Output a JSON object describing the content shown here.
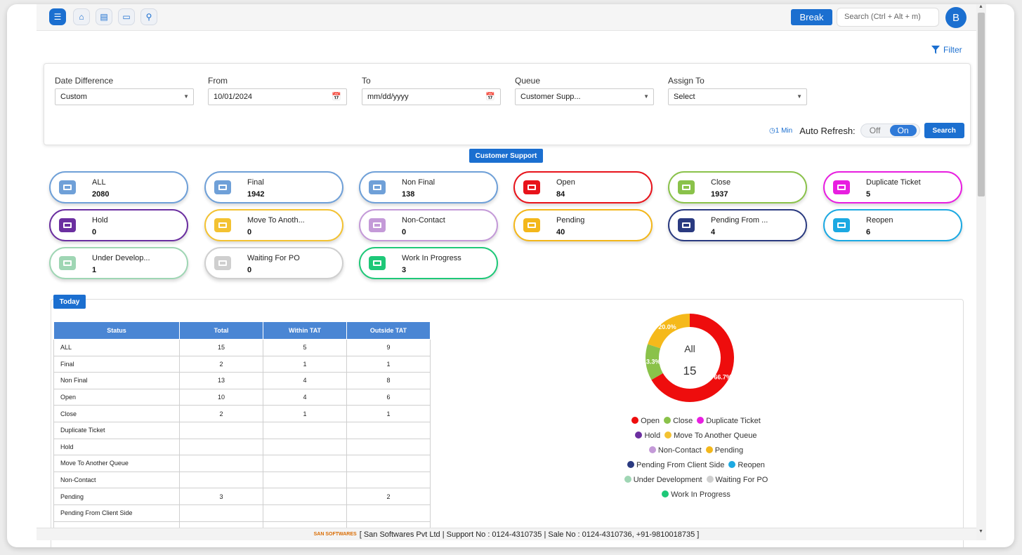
{
  "topbar": {
    "icons": [
      "menu-icon",
      "home-icon",
      "document-icon",
      "ticket-icon",
      "search-icon"
    ],
    "break_label": "Break",
    "search_placeholder": "Search (Ctrl + Alt + m)",
    "avatar_initial": "B"
  },
  "filter_link": "Filter",
  "filters": {
    "date_difference": {
      "label": "Date Difference",
      "value": "Custom"
    },
    "from": {
      "label": "From",
      "value": "10/01/2024"
    },
    "to": {
      "label": "To",
      "value": "mm/dd/yyyy"
    },
    "queue": {
      "label": "Queue",
      "value": "Customer Supp..."
    },
    "assign_to": {
      "label": "Assign To",
      "value": "Select"
    },
    "refresh_interval": "1 Min",
    "auto_refresh_label": "Auto Refresh:",
    "toggle_off": "Off",
    "toggle_on": "On",
    "search_button": "Search"
  },
  "section_title": "Customer Support",
  "status_cards": [
    {
      "label": "ALL",
      "count": "2080",
      "color": "#6fa0d8"
    },
    {
      "label": "Final",
      "count": "1942",
      "color": "#6fa0d8"
    },
    {
      "label": "Non Final",
      "count": "138",
      "color": "#6fa0d8"
    },
    {
      "label": "Open",
      "count": "84",
      "color": "#e8131b"
    },
    {
      "label": "Close",
      "count": "1937",
      "color": "#8ac24a"
    },
    {
      "label": "Duplicate Ticket",
      "count": "5",
      "color": "#e81ee0"
    },
    {
      "label": "Hold",
      "count": "0",
      "color": "#6b2fa0"
    },
    {
      "label": "Move To Anoth...",
      "count": "0",
      "color": "#f3c232"
    },
    {
      "label": "Non-Contact",
      "count": "0",
      "color": "#c49ad8"
    },
    {
      "label": "Pending",
      "count": "40",
      "color": "#f3b71b"
    },
    {
      "label": "Pending From ...",
      "count": "4",
      "color": "#2a3a80"
    },
    {
      "label": "Reopen",
      "count": "6",
      "color": "#1ca9e2"
    },
    {
      "label": "Under Develop...",
      "count": "1",
      "color": "#9fd6b4"
    },
    {
      "label": "Waiting For PO",
      "count": "0",
      "color": "#cfcfcf"
    },
    {
      "label": "Work In Progress",
      "count": "3",
      "color": "#1ec878"
    }
  ],
  "today": {
    "title": "Today",
    "columns": [
      "Status",
      "Total",
      "Within TAT",
      "Outside TAT"
    ],
    "rows": [
      [
        "ALL",
        "15",
        "5",
        "9"
      ],
      [
        "Final",
        "2",
        "1",
        "1"
      ],
      [
        "Non Final",
        "13",
        "4",
        "8"
      ],
      [
        "Open",
        "10",
        "4",
        "6"
      ],
      [
        "Close",
        "2",
        "1",
        "1"
      ],
      [
        "Duplicate Ticket",
        "",
        "",
        ""
      ],
      [
        "Hold",
        "",
        "",
        ""
      ],
      [
        "Move To Another Queue",
        "",
        "",
        ""
      ],
      [
        "Non-Contact",
        "",
        "",
        ""
      ],
      [
        "Pending",
        "3",
        "",
        "2"
      ],
      [
        "Pending From Client Side",
        "",
        "",
        ""
      ],
      [
        "",
        "",
        "",
        ""
      ]
    ]
  },
  "chart_data": {
    "type": "pie",
    "center_label": "All",
    "center_value": "15",
    "slices": [
      {
        "name": "Open",
        "value": 66.7,
        "label": "66.7%",
        "color": "#ee0d0d"
      },
      {
        "name": "Close",
        "value": 13.3,
        "label": "13.3%",
        "color": "#8ac24a"
      },
      {
        "name": "Pending",
        "value": 20.0,
        "label": "20.0%",
        "color": "#f5b91b"
      }
    ],
    "legend": [
      {
        "name": "Open",
        "color": "#ee0d0d"
      },
      {
        "name": "Close",
        "color": "#8ac24a"
      },
      {
        "name": "Duplicate Ticket",
        "color": "#e81ee0"
      },
      {
        "name": "Hold",
        "color": "#6b2fa0"
      },
      {
        "name": "Move To Another Queue",
        "color": "#f3c232"
      },
      {
        "name": "Non-Contact",
        "color": "#c49ad8"
      },
      {
        "name": "Pending",
        "color": "#f3b71b"
      },
      {
        "name": "Pending From Client Side",
        "color": "#2a3a80"
      },
      {
        "name": "Reopen",
        "color": "#1ca9e2"
      },
      {
        "name": "Under Development",
        "color": "#9fd6b4"
      },
      {
        "name": "Waiting For PO",
        "color": "#cfcfcf"
      },
      {
        "name": "Work In Progress",
        "color": "#1ec878"
      }
    ]
  },
  "footer": {
    "logo_text": "SAN SOFTWARES",
    "text": "[ San Softwares Pvt Ltd | Support No : 0124-4310735 | Sale No : 0124-4310736, +91-9810018735 ]"
  }
}
